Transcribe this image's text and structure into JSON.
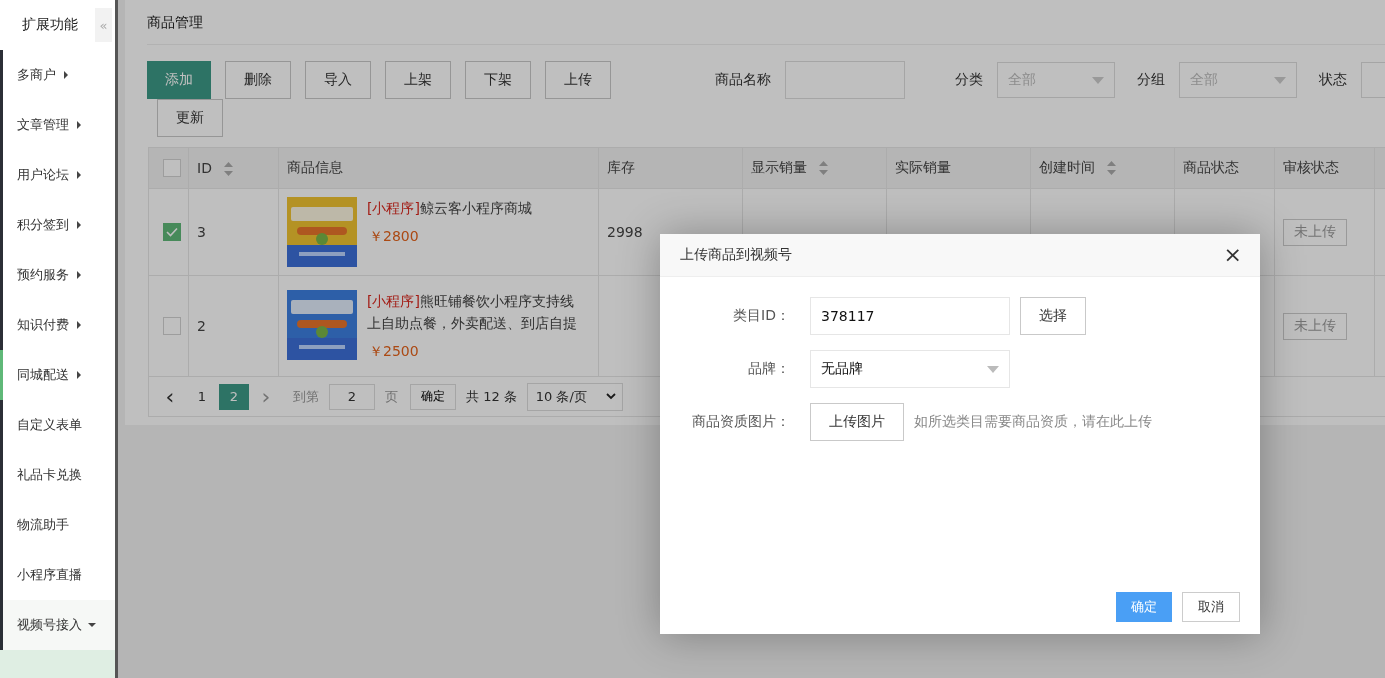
{
  "sidebar": {
    "title": "扩展功能",
    "collapse_icon": "«",
    "items": [
      {
        "label": "多商户",
        "kind": "submenu",
        "expanded": false,
        "selected": false
      },
      {
        "label": "文章管理",
        "kind": "submenu",
        "expanded": false,
        "selected": false
      },
      {
        "label": "用户论坛",
        "kind": "submenu",
        "expanded": false,
        "selected": false
      },
      {
        "label": "积分签到",
        "kind": "submenu",
        "expanded": false,
        "selected": false
      },
      {
        "label": "预约服务",
        "kind": "submenu",
        "expanded": false,
        "selected": false
      },
      {
        "label": "知识付费",
        "kind": "submenu",
        "expanded": false,
        "selected": false
      },
      {
        "label": "同城配送",
        "kind": "submenu",
        "expanded": false,
        "selected": true
      },
      {
        "label": "自定义表单",
        "kind": "link",
        "selected": false
      },
      {
        "label": "礼品卡兑换",
        "kind": "link",
        "selected": false
      },
      {
        "label": "物流助手",
        "kind": "link",
        "selected": false
      },
      {
        "label": "小程序直播",
        "kind": "link",
        "selected": false
      },
      {
        "label": "视频号接入",
        "kind": "submenu",
        "expanded": true,
        "selected": false
      }
    ]
  },
  "page": {
    "title": "商品管理",
    "toolbar": [
      {
        "label": "添加",
        "primary": true
      },
      {
        "label": "删除",
        "primary": false
      },
      {
        "label": "导入",
        "primary": false
      },
      {
        "label": "上架",
        "primary": false
      },
      {
        "label": "下架",
        "primary": false
      },
      {
        "label": "上传",
        "primary": false
      },
      {
        "label": "更新",
        "primary": false
      }
    ],
    "filters": [
      {
        "label": "商品名称",
        "kind": "input"
      },
      {
        "label": "分类",
        "kind": "select",
        "value": "全部"
      },
      {
        "label": "分组",
        "kind": "select",
        "value": "全部"
      },
      {
        "label": "状态",
        "kind": "select"
      }
    ],
    "table": {
      "all_checked": false,
      "columns": [
        {
          "label": "ID",
          "sortable": true
        },
        {
          "label": "商品信息",
          "sortable": false
        },
        {
          "label": "库存",
          "sortable": false
        },
        {
          "label": "显示销量",
          "sortable": true
        },
        {
          "label": "实际销量",
          "sortable": false
        },
        {
          "label": "创建时间",
          "sortable": true
        },
        {
          "label": "商品状态",
          "sortable": false
        },
        {
          "label": "审核状态",
          "sortable": false
        }
      ],
      "rows": [
        {
          "checked": true,
          "id": "3",
          "tag": "[小程序]",
          "name": "鲸云客小程序商城",
          "price": "￥2800",
          "stock": "2998",
          "audit": "未上传"
        },
        {
          "checked": false,
          "id": "2",
          "tag": "[小程序]",
          "name": "熊旺铺餐饮小程序支持线上自助点餐，外卖配送、到店自提",
          "price": "￥2500",
          "audit": "未上传"
        }
      ]
    },
    "pagination": {
      "prev": "‹",
      "pages": [
        {
          "label": "1",
          "selected": false
        },
        {
          "label": "2",
          "selected": true
        }
      ],
      "next": "›",
      "goto_label": "到第",
      "goto_value": "2",
      "page_label": "页",
      "confirm": "确定",
      "total": "共 12 条",
      "page_size": "10 条/页"
    }
  },
  "dialog": {
    "title": "上传商品到视频号",
    "close": "×",
    "category_label": "类目ID：",
    "category_value": "378117",
    "choose": "选择",
    "brand_label": "品牌：",
    "brand_value": "无品牌",
    "image_label": "商品资质图片：",
    "upload": "上传图片",
    "hint": "如所选类目需要商品资质，请在此上传",
    "ok": "确定",
    "cancel": "取消"
  }
}
